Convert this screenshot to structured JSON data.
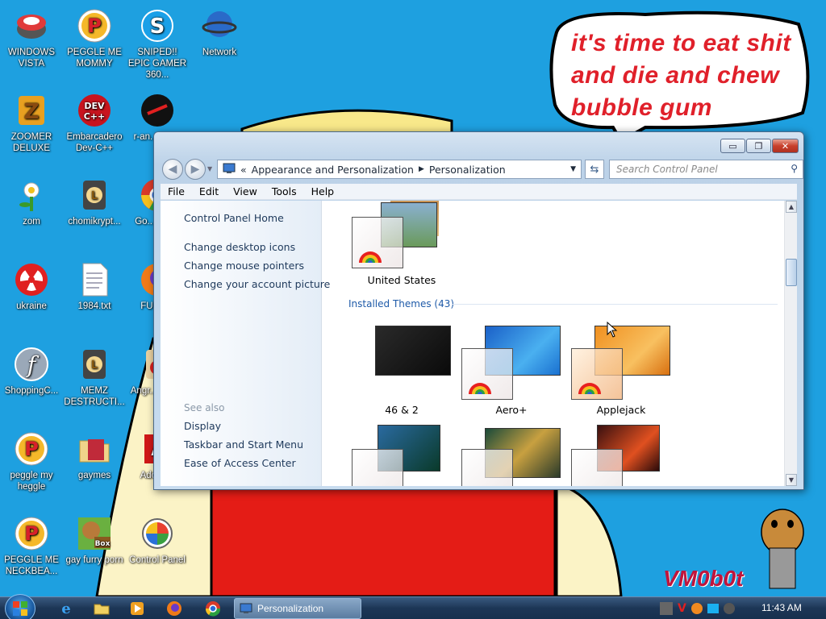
{
  "desktop": {
    "icons": [
      {
        "label": "WINDOWS VISTA",
        "icon": "vista-bowl-icon"
      },
      {
        "label": "PEGGLE ME MOMMY",
        "icon": "peggle-icon"
      },
      {
        "label": "SNIPED!! EPIC GAMER 360...",
        "icon": "skype-icon"
      },
      {
        "label": "Network",
        "icon": "network-icon"
      },
      {
        "label": "ZOOMER DELUXE",
        "icon": "zuma-icon"
      },
      {
        "label": "Embarcadero Dev-C++",
        "icon": "devcpp-icon"
      },
      {
        "label": "r-an... par...",
        "icon": "circle-app-icon"
      },
      {
        "label": "zom",
        "icon": "flower-icon"
      },
      {
        "label": "chomikrypt...",
        "icon": "hourglass-app-icon"
      },
      {
        "label": "Go... Chr...",
        "icon": "chrome-icon"
      },
      {
        "label": "ukraine",
        "icon": "radiation-icon"
      },
      {
        "label": "1984.txt",
        "icon": "text-file-icon"
      },
      {
        "label": "FURR...",
        "icon": "firefox-icon"
      },
      {
        "label": "ShoppingC...",
        "icon": "flash-icon"
      },
      {
        "label": "MEMZ DESTRUCTI...",
        "icon": "hourglass-app-icon"
      },
      {
        "label": "Angr... Sea...",
        "icon": "angry-birds-icon"
      },
      {
        "label": "peggle my heggle",
        "icon": "peggle-icon"
      },
      {
        "label": "gaymes",
        "icon": "folder-icon"
      },
      {
        "label": "Adobe...",
        "icon": "adobe-icon"
      },
      {
        "label": "PEGGLE ME NECKBEA...",
        "icon": "peggle-icon"
      },
      {
        "label": "gay furry porn",
        "icon": "gopher-box-icon"
      },
      {
        "label": "Control Panel",
        "icon": "control-panel-icon"
      }
    ],
    "speech_bubble": "it's time to eat shit and die and chew bubble gum",
    "signature": "VM0b0t"
  },
  "window": {
    "title": "Personalization",
    "controls": {
      "minimize": "▭",
      "maximize": "❐",
      "close": "✕"
    },
    "address": {
      "prefix": "«",
      "crumbs": [
        "Appearance and Personalization",
        "Personalization"
      ]
    },
    "search_placeholder": "Search Control Panel",
    "menu": [
      "File",
      "Edit",
      "View",
      "Tools",
      "Help"
    ],
    "left_links": [
      "Control Panel Home",
      "Change desktop icons",
      "Change mouse pointers",
      "Change your account picture"
    ],
    "see_also": {
      "header": "See also",
      "links": [
        "Display",
        "Taskbar and Start Menu",
        "Ease of Access Center"
      ]
    },
    "top_theme": "United States",
    "installed_header": "Installed Themes (43)",
    "themes_row1": [
      "46 & 2",
      "Aero+",
      "Applejack"
    ],
    "colors": {
      "link": "#1e395b",
      "section": "#1e5aa8"
    }
  },
  "taskbar": {
    "active_task": "Personalization",
    "clock": "11:43 AM",
    "pinned": [
      "internet-explorer-icon",
      "explorer-icon",
      "media-player-icon",
      "firefox-icon",
      "chrome-icon"
    ]
  }
}
